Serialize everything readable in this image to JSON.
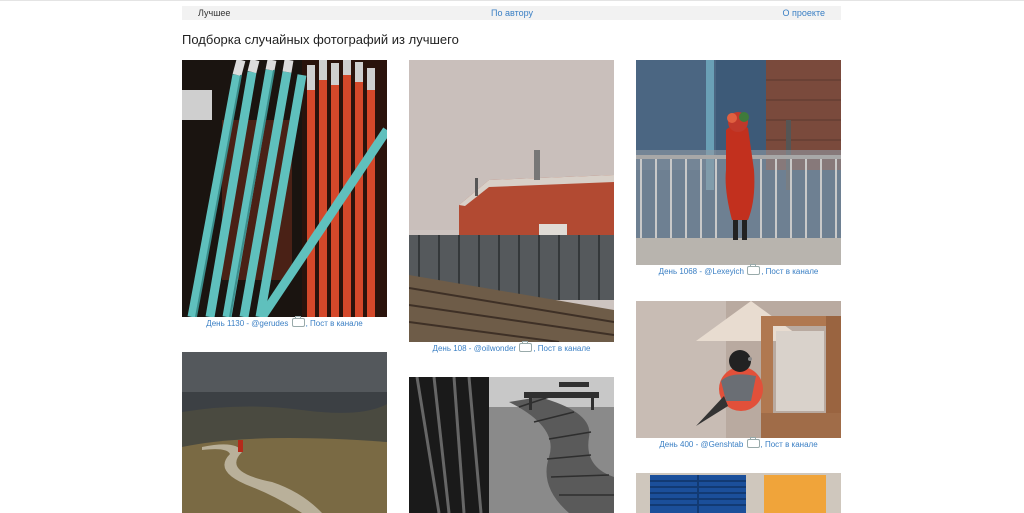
{
  "nav": {
    "items": [
      "Лучшее",
      "По автору",
      "О проекте"
    ]
  },
  "heading": "Подборка случайных фотографий из лучшего",
  "captions": [
    {
      "day": "День 1130",
      "author": "@gerudes",
      "post": "Пост в канале"
    },
    {
      "day": "День 108",
      "author": "@oilwonder",
      "post": "Пост в канале"
    },
    {
      "day": "День 1068",
      "author": "@Lexeyich",
      "post": "Пост в канале"
    },
    {
      "day": "День 400",
      "author": "@Genshtab",
      "post": "Пост в канале"
    }
  ],
  "separator": " - ",
  "comma": ",",
  "icons": {
    "telegram": "camera-icon"
  }
}
